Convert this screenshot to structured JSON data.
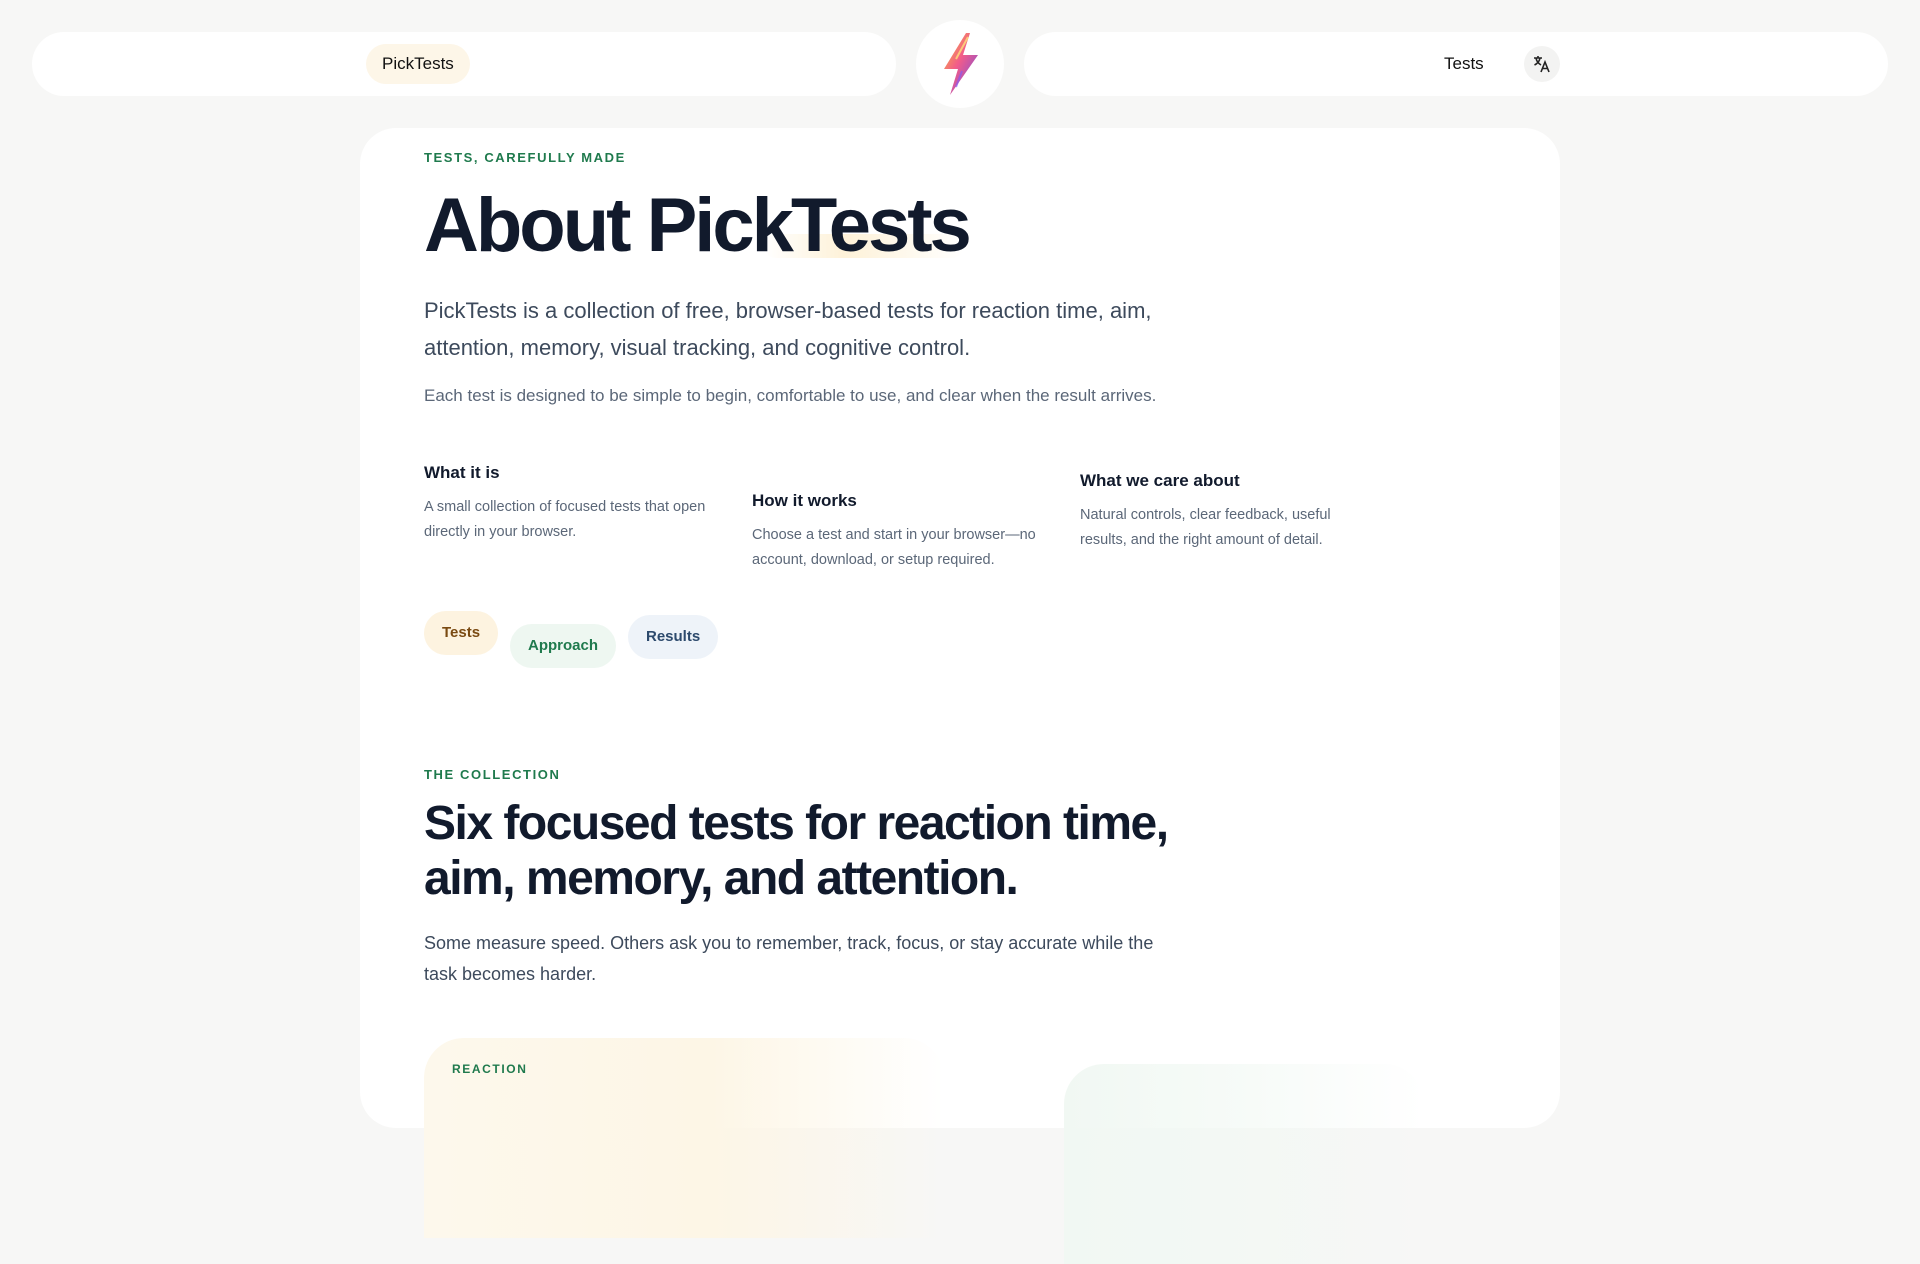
{
  "header": {
    "brand_label": "PickTests",
    "logo_icon": "lightning-bolt-icon",
    "nav_tests_label": "Tests",
    "language_icon": "translate-icon"
  },
  "hero": {
    "eyebrow": "TESTS, CAREFULLY MADE",
    "title": "About PickTests",
    "lead": "PickTests is a collection of free, browser-based tests for reaction time, aim, attention, memory, visual tracking, and cognitive control.",
    "sub": "Each test is designed to be simple to begin, comfortable to use, and clear when the result arrives."
  },
  "features": [
    {
      "title": "What it is",
      "body": "A small collection of focused tests that open directly in your browser."
    },
    {
      "title": "How it works",
      "body": "Choose a test and start in your browser—no account, download, or setup required."
    },
    {
      "title": "What we care about",
      "body": "Natural controls, clear feedback, useful results, and the right amount of detail."
    }
  ],
  "chips": [
    "Tests",
    "Approach",
    "Results"
  ],
  "collection": {
    "eyebrow": "THE COLLECTION",
    "title": "Six focused tests for reaction time, aim, memory, and attention.",
    "body": "Some measure speed. Others ask you to remember, track, focus, or stay accurate while the task becomes harder.",
    "first_tile_eyebrow": "REACTION"
  },
  "colors": {
    "background": "#f7f7f6",
    "accent_green": "#1f7a4d",
    "heading": "#111a2c",
    "chip_warm": "#fdf3e0",
    "chip_green": "#eef7f1",
    "chip_blue": "#eef3f9"
  }
}
